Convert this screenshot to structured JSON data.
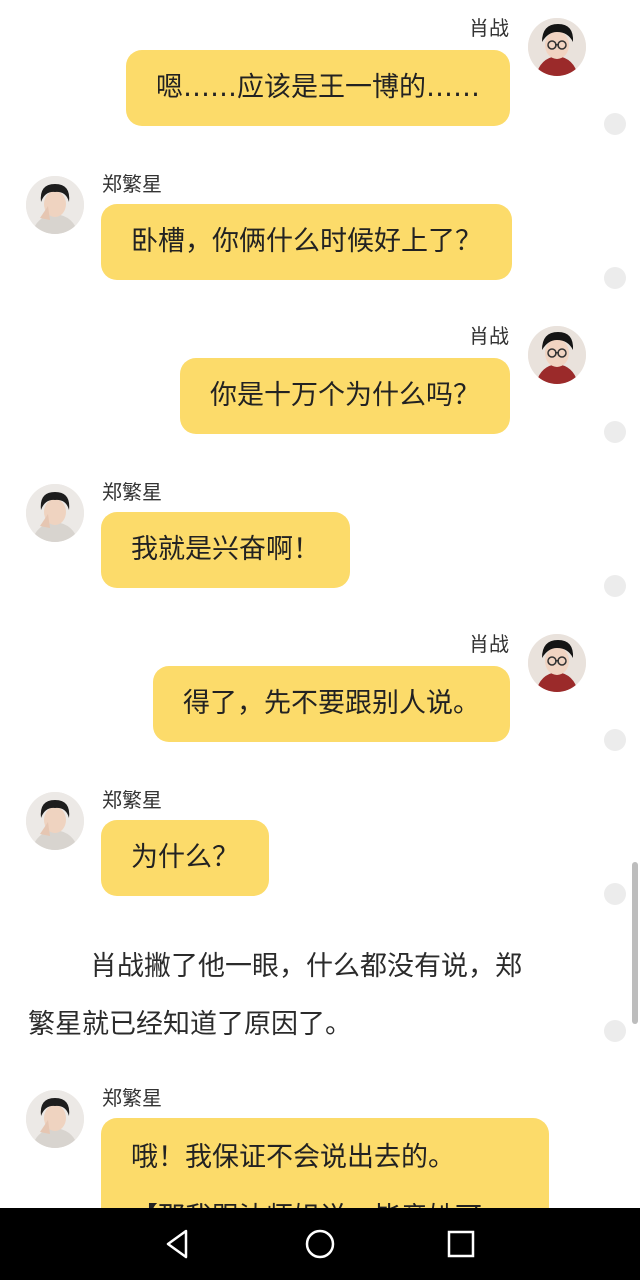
{
  "messages": [
    {
      "side": "right",
      "name": "肖战",
      "text": "嗯……应该是王一博的……"
    },
    {
      "side": "left",
      "name": "郑繁星",
      "text": "卧槽，你俩什么时候好上了？"
    },
    {
      "side": "right",
      "name": "肖战",
      "text": "你是十万个为什么吗？"
    },
    {
      "side": "left",
      "name": "郑繁星",
      "text": "我就是兴奋啊！"
    },
    {
      "side": "right",
      "name": "肖战",
      "text": "得了，先不要跟别人说。"
    },
    {
      "side": "left",
      "name": "郑繁星",
      "text": "为什么？"
    },
    {
      "side": "left",
      "name": "郑繁星",
      "text": "哦！我保证不会说出去的。",
      "text2": "【那我跟沈师姐说，毕竟她可"
    }
  ],
  "narration": {
    "line1": "肖战撇了他一眼，什么都没有说，郑",
    "line2": "繁星就已经知道了原因了。"
  },
  "colors": {
    "bubble": "#fcdb6a",
    "background": "#ffffff",
    "navbar": "#000000"
  },
  "navbar": {
    "icons": [
      "back-icon",
      "home-icon",
      "recent-apps-icon"
    ]
  }
}
